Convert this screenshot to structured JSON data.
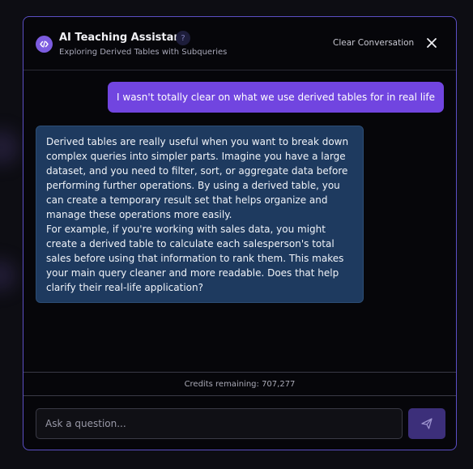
{
  "header": {
    "title": "AI Teaching Assistant",
    "subtitle": "Exploring Derived Tables with Subqueries",
    "help_label": "?",
    "clear_label": "Clear Conversation",
    "logo_icon": "code-icon",
    "close_icon": "close-icon"
  },
  "messages": {
    "user": "I wasn't totally clear on what we use derived tables for in real life",
    "assistant": {
      "paragraph1": "Derived tables are really useful when you want to break down complex queries into simpler parts. Imagine you have a large dataset, and you need to filter, sort, or aggregate data before performing further operations. By using a derived table, you can create a temporary result set that helps organize and manage these operations more easily.",
      "paragraph2": "For example, if you're working with sales data, you might create a derived table to calculate each salesperson's total sales before using that information to rank them. This makes your main query cleaner and more readable. Does that help clarify their real-life application?"
    }
  },
  "footer": {
    "credits": "Credits remaining: 707,277"
  },
  "input": {
    "value": "",
    "placeholder": "Ask a question...",
    "send_icon": "send-icon"
  },
  "colors": {
    "accent": "#7145e0",
    "panel_border": "#5b4fc4",
    "assistant_bubble": "#1e3a5f",
    "send_button": "#3c2f7a"
  }
}
